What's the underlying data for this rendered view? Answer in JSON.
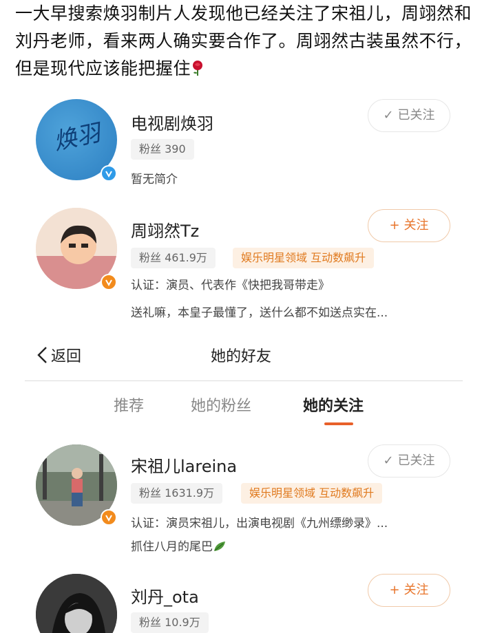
{
  "post": {
    "caption": "一大早搜索焕羽制片人发现他已经关注了宋祖儿，周翊然和刘丹老师，看来两人确实要合作了。周翊然古装虽然不行，但是现代应该能把握住"
  },
  "accounts_top": [
    {
      "name": "电视剧焕羽",
      "fans": "粉丝 390",
      "desc1": "暂无简介",
      "button": "已关注",
      "button_glyph": "✓",
      "avatar_text": "焕羽"
    },
    {
      "name": "周翊然Tz",
      "fans": "粉丝 461.9万",
      "tag": "娱乐明星领域 互动数飙升",
      "desc1": "认证：演员、代表作《快把我哥带走》",
      "desc2": "送礼嘛，本皇子最懂了，送什么都不如送点实在...",
      "button": "关注",
      "button_glyph": "+"
    }
  ],
  "navbar": {
    "back_label": "返回",
    "title": "她的好友"
  },
  "tabs": [
    {
      "label": "推荐"
    },
    {
      "label": "她的粉丝"
    },
    {
      "label": "她的关注"
    }
  ],
  "accounts_bottom": [
    {
      "name": "宋祖儿lareina",
      "fans": "粉丝 1631.9万",
      "tag": "娱乐明星领域 互动数飙升",
      "desc1": "认证：演员宋祖儿，出演电视剧《九州缥缈录》...",
      "desc2": "抓住八月的尾巴",
      "button": "已关注",
      "button_glyph": "✓"
    },
    {
      "name": "刘丹_ota",
      "fans": "粉丝 10.9万",
      "button": "关注",
      "button_glyph": "+"
    }
  ],
  "colors": {
    "accent": "#e8602a",
    "verified_blue": "#2f9be8",
    "verified_orange": "#f28b1d",
    "tag_text": "#e07a1f",
    "tag_bg": "#fdf0e3"
  },
  "icons": [
    "rose-icon",
    "check-icon",
    "plus-icon",
    "verified-badge-icon",
    "back-chevron-icon",
    "leaf-icon"
  ]
}
